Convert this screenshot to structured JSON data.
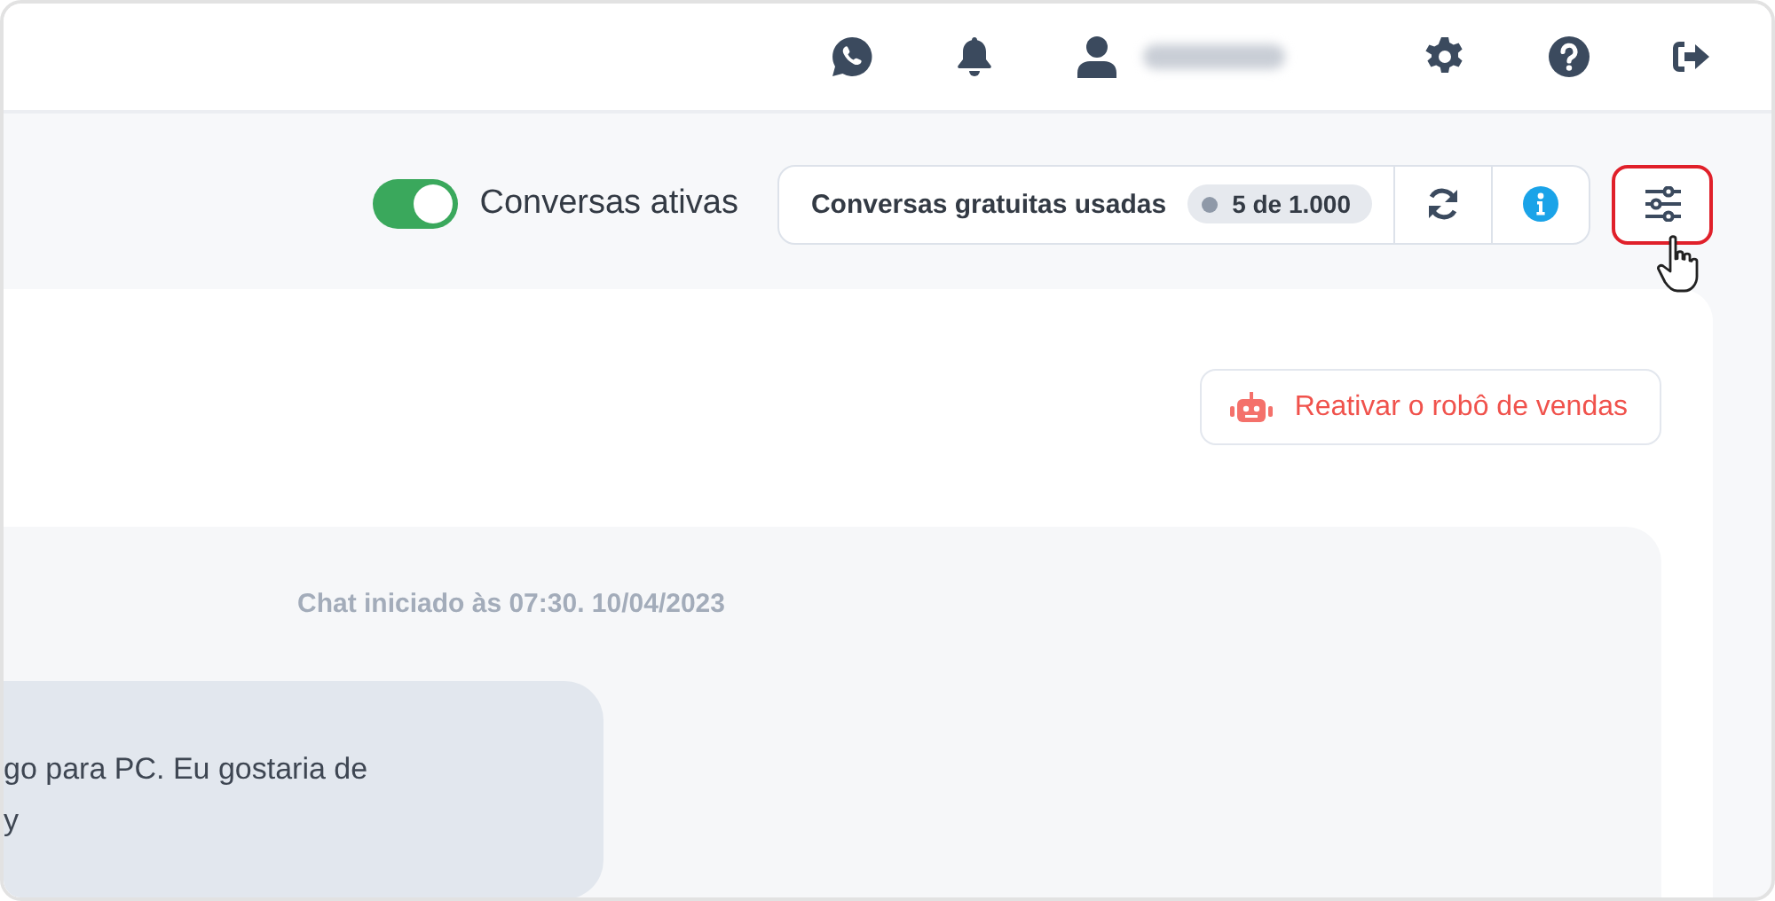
{
  "toolbar": {
    "toggle": {
      "label": "Conversas ativas",
      "on": true
    },
    "usage": {
      "label": "Conversas gratuitas usadas",
      "count": "5 de 1.000"
    },
    "filter_button": {
      "highlighted": true
    }
  },
  "card": {
    "robot_button": {
      "label": "Reativar o robô de vendas"
    },
    "chat": {
      "started": "Chat iniciado às 07:30. 10/04/2023",
      "messages": [
        {
          "text": "go para PC. Eu gostaria de\ny"
        }
      ]
    }
  }
}
